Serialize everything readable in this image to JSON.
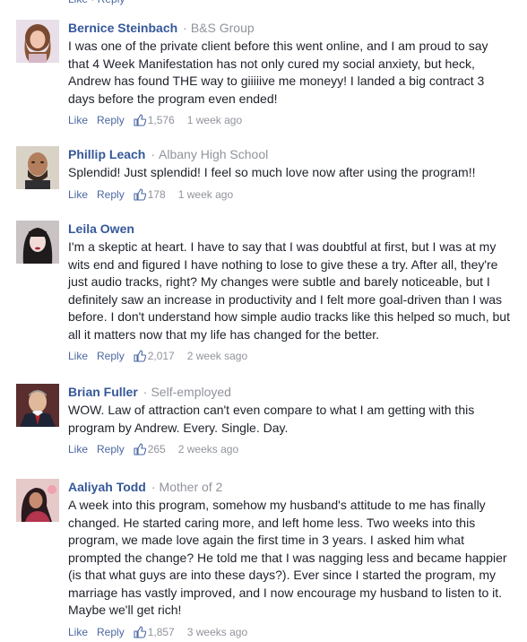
{
  "comments": [
    {
      "name": "Bernice Steinbach",
      "affiliation": "B&S Group",
      "text": "I was one of the private client before this went online, and I am proud to say that 4 Week Manifestation has not only cured my social anxiety, but heck, Andrew has found THE way to giiiiive me moneyy! I landed a big contract 3 days before the program even ended!",
      "like_label": "Like",
      "reply_label": "Reply",
      "likes": "1,576",
      "time": "1 week ago",
      "avatar_color": "#c98b6a"
    },
    {
      "name": "Phillip Leach",
      "affiliation": "Albany High School",
      "text": "Splendid! Just splendid! I feel so much love now after using the program!!",
      "like_label": "Like",
      "reply_label": "Reply",
      "likes": "178",
      "time": "1 week ago",
      "avatar_color": "#8a6a52"
    },
    {
      "name": "Leila Owen",
      "affiliation": "",
      "text": "I'm a skeptic at heart. I have to say that I was doubtful at first, but I was at my wits end and figured I have nothing to lose to give these a try. After all, they're just audio tracks, right? My changes were subtle and barely noticeable, but I definitely saw an increase in productivity and I felt more goal-driven than I was before. I don't understand how simple audio tracks like this helped so much, but all it matters now that my life has changed for the better.",
      "like_label": "Like",
      "reply_label": "Reply",
      "likes": "2,017",
      "time": "2 week sago",
      "avatar_color": "#3a2b2b"
    },
    {
      "name": "Brian Fuller",
      "affiliation": "Self-employed",
      "text": "WOW. Law of attraction can't even compare to what I am getting with this program by Andrew. Every. Single. Day.",
      "like_label": "Like",
      "reply_label": "Reply",
      "likes": "265",
      "time": "2 weeks ago",
      "avatar_color": "#2b3450"
    },
    {
      "name": "Aaliyah Todd",
      "affiliation": "Mother of 2",
      "text": "A week into this program, somehow my husband's attitude to me has finally changed. He started caring more, and left home less. Two weeks into this program, we made love again the first time in 3 years. I asked him what prompted the change? He told me that I was nagging less and became happier (is that what guys are into these days?). Ever since I started the program, my marriage has vastly improved, and I now encourage my husband to listen to it. Maybe we'll get rich!",
      "like_label": "Like",
      "reply_label": "Reply",
      "likes": "1,857",
      "time": "3 weeks ago",
      "avatar_color": "#6b2a3a"
    }
  ],
  "colors": {
    "link": "#365899",
    "action_link": "#4b67a1",
    "meta": "#90949c",
    "text": "#1d2129"
  }
}
